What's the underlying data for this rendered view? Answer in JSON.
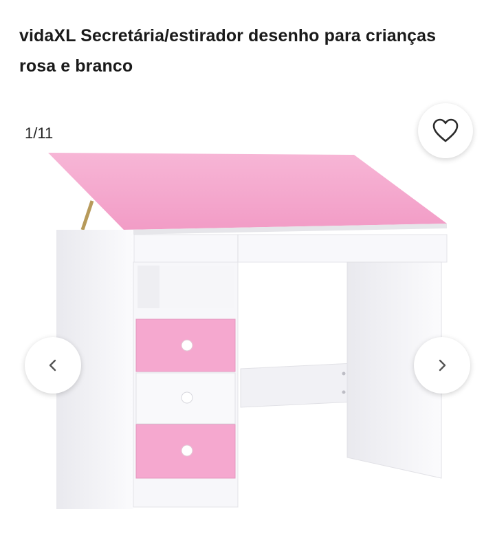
{
  "product": {
    "title": "vidaXL Secretária/estirador desenho para crianças rosa e branco"
  },
  "gallery": {
    "counter": "1/11",
    "image_alt": "Secretária/estirador de desenho infantil rosa e branco"
  },
  "icons": {
    "favorite": "heart-outline-icon",
    "prev": "chevron-left-icon",
    "next": "chevron-right-icon"
  },
  "colors": {
    "pink": "#f5a9cf",
    "white_body": "#f6f6f8",
    "accent_text": "#1a1a1a"
  }
}
